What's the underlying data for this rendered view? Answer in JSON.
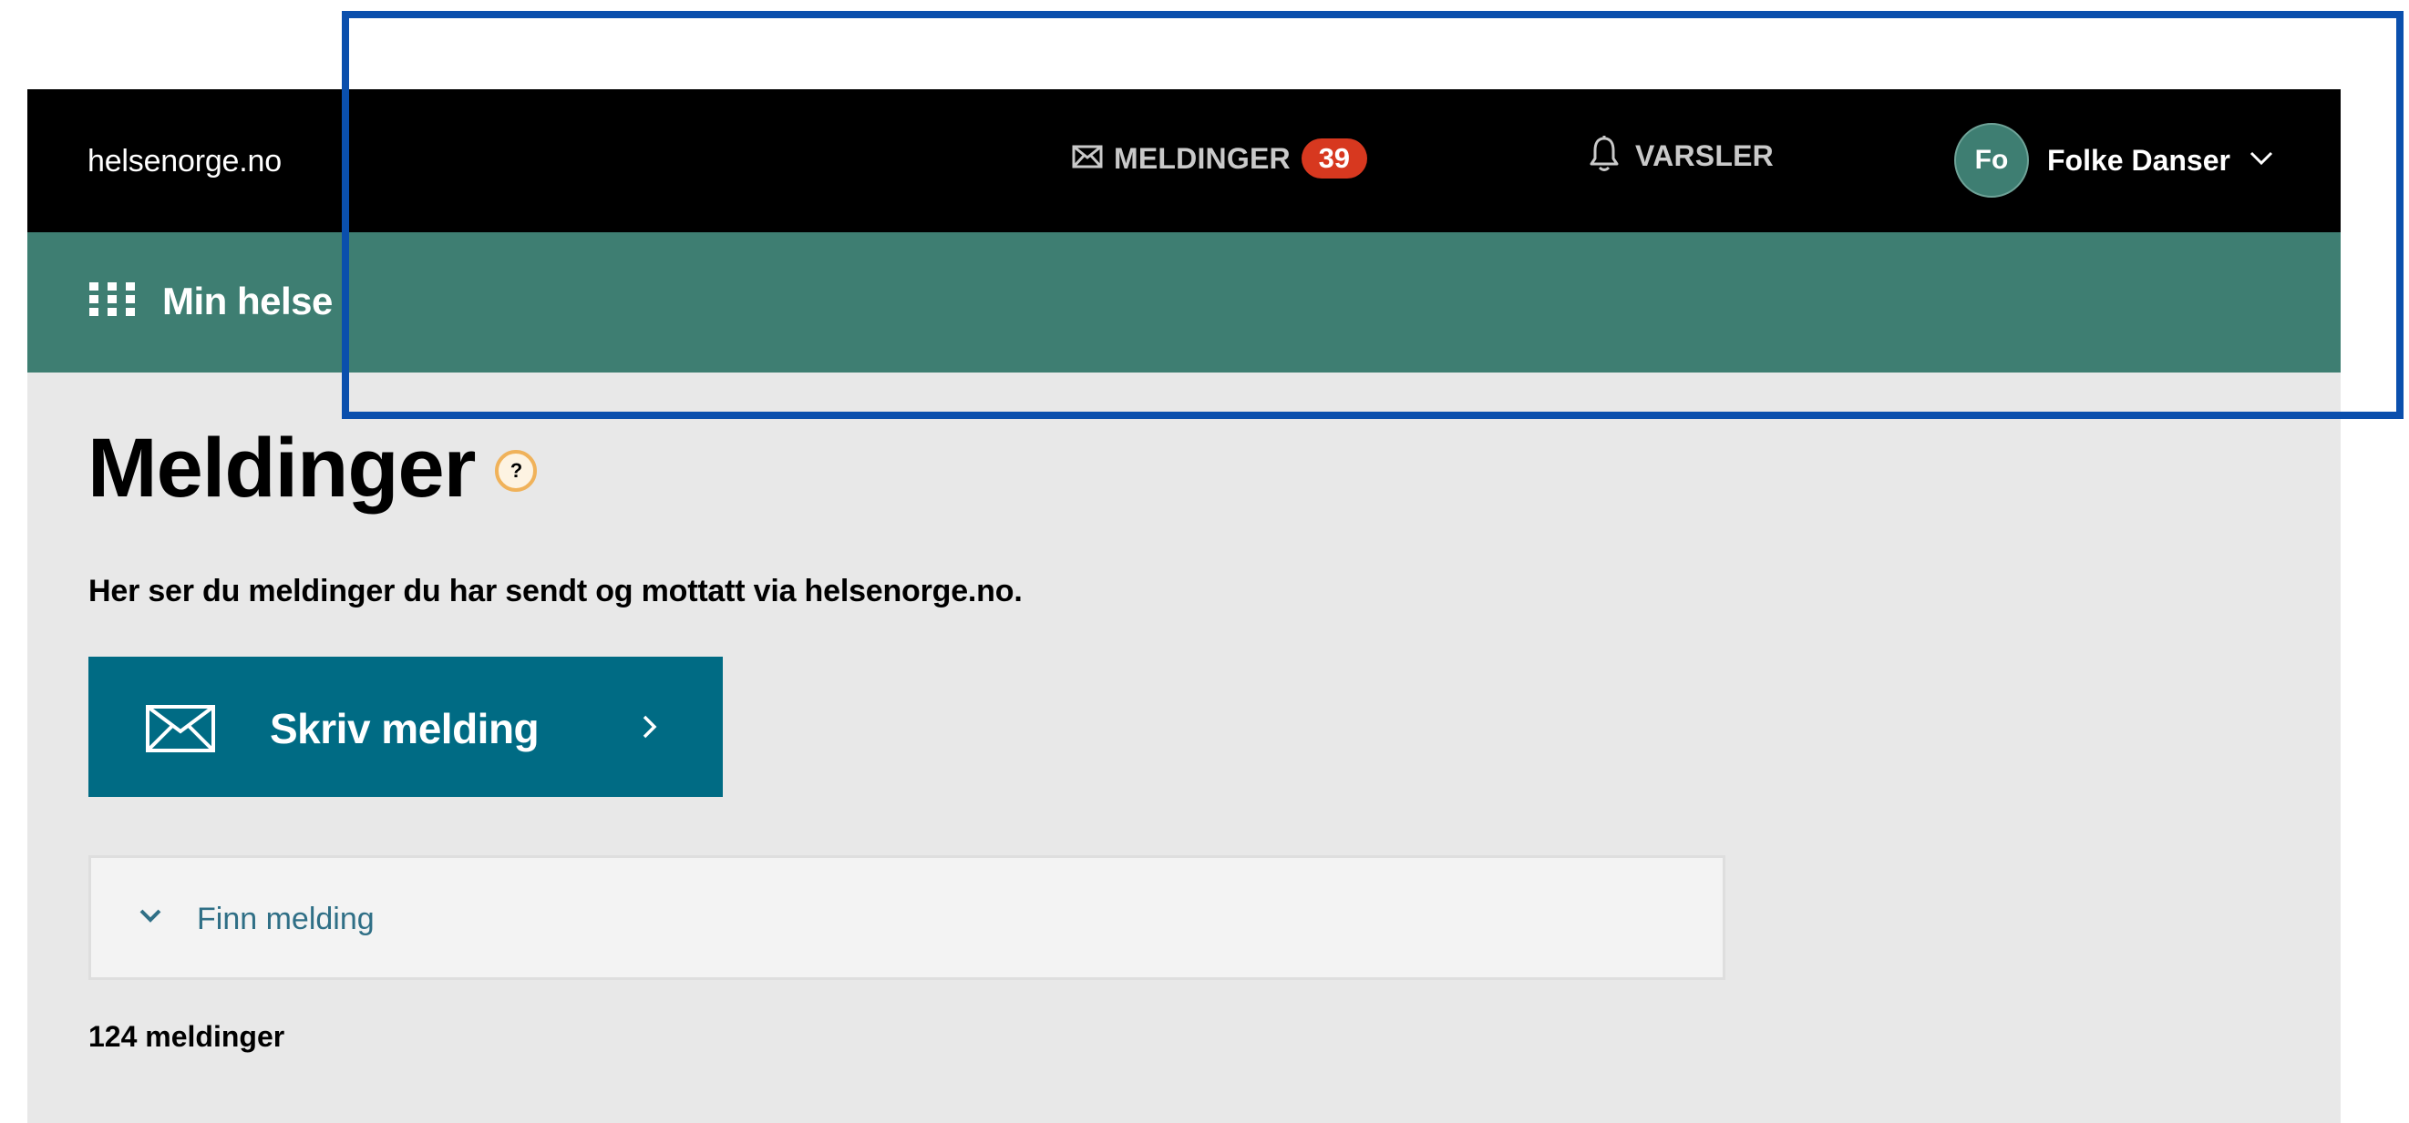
{
  "header": {
    "brand": "helsenorge.no",
    "messages_label": "MELDINGER",
    "messages_count": "39",
    "alerts_label": "VARSLER",
    "user_initials": "Fo",
    "user_name": "Folke Danser"
  },
  "subheader": {
    "menu_label": "Min helse"
  },
  "main": {
    "title": "Meldinger",
    "help_icon_text": "?",
    "intro": "Her ser du meldinger du har sendt og mottatt via helsenorge.no.",
    "write_button_label": "Skriv melding",
    "finder_label": "Finn melding",
    "message_count": "124 meldinger"
  },
  "icons": {
    "messages": "envelope-icon",
    "alerts": "bell-icon",
    "user_menu": "chevron-down-icon",
    "app_menu": "grid-icon",
    "help": "help-icon",
    "write": "envelope-icon",
    "write_arrow": "chevron-right-icon",
    "finder": "chevron-down-icon"
  },
  "colors": {
    "topbar": "#000000",
    "greenbar": "#3e7e72",
    "badge": "#d7381f",
    "primary_button": "#006b84",
    "highlight_frame": "#0a4fad"
  }
}
